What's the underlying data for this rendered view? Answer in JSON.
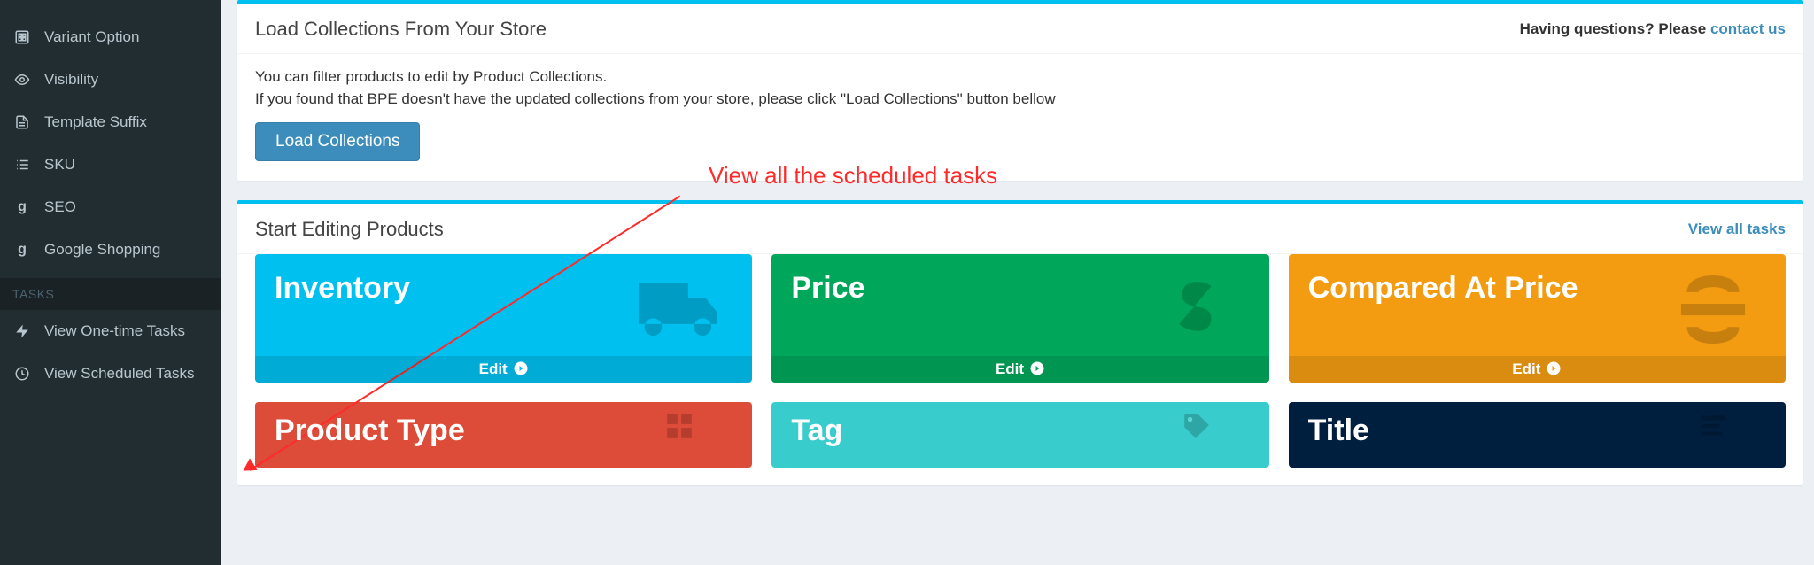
{
  "sidebar": {
    "items": [
      {
        "label": "Variant Option",
        "icon": "grid-icon"
      },
      {
        "label": "Visibility",
        "icon": "eye-icon"
      },
      {
        "label": "Template Suffix",
        "icon": "file-icon"
      },
      {
        "label": "SKU",
        "icon": "list-icon"
      },
      {
        "label": "SEO",
        "icon": "g-icon"
      },
      {
        "label": "Google Shopping",
        "icon": "g-icon"
      }
    ],
    "section_label": "TASKS",
    "task_items": [
      {
        "label": "View One-time Tasks",
        "icon": "bolt-icon"
      },
      {
        "label": "View Scheduled Tasks",
        "icon": "clock-icon"
      }
    ]
  },
  "panel_load": {
    "title": "Load Collections From Your Store",
    "help_prefix": "Having questions? Please ",
    "help_link": "contact us",
    "line1": "You can filter products to edit by Product Collections.",
    "line2": "If you found that BPE doesn't have the updated collections from your store, please click \"Load Collections\" button bellow",
    "button": "Load Collections"
  },
  "panel_start": {
    "title": "Start Editing Products",
    "view_all": "View all tasks",
    "edit_label": "Edit",
    "cards": [
      {
        "title": "Inventory",
        "color": "c-blue",
        "bg": "truck-icon"
      },
      {
        "title": "Price",
        "color": "c-green",
        "bg": "dollar-icon"
      },
      {
        "title": "Compared At Price",
        "color": "c-orange",
        "bg": "strike-icon"
      },
      {
        "title": "Product Type",
        "color": "c-red",
        "bg": "grid-icon"
      },
      {
        "title": "Tag",
        "color": "c-teal",
        "bg": "tag-icon"
      },
      {
        "title": "Title",
        "color": "c-navy",
        "bg": "title-icon"
      }
    ]
  },
  "annotation": {
    "text": "View all the scheduled tasks"
  },
  "colors": {
    "sidebar_bg": "#222d32",
    "accent_blue": "#00c0ef",
    "btn": "#3c8dbc",
    "cards": {
      "blue": "#00c0ef",
      "green": "#00a65a",
      "orange": "#f39c12",
      "red": "#dd4b39",
      "teal": "#39cccc",
      "navy": "#001f3f"
    },
    "annotation": "#ff2a2a"
  }
}
